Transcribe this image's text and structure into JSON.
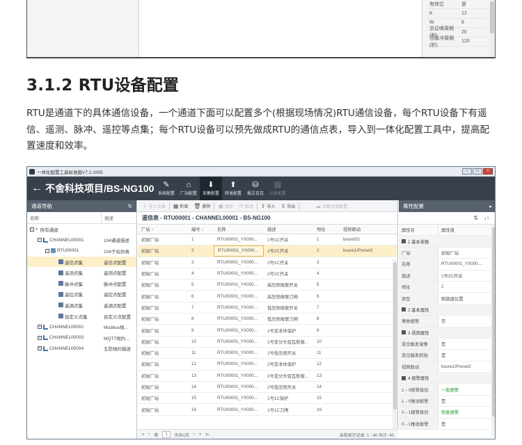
{
  "top_props": [
    {
      "k": "有效位",
      "v": "是"
    },
    {
      "k": "K",
      "v": "12"
    },
    {
      "k": "W",
      "v": "8"
    },
    {
      "k": "总召唤周期(秒)",
      "v": "20"
    },
    {
      "k": "召脉冲周期(秒)",
      "v": "120"
    }
  ],
  "section_title": "3.1.2 RTU设备配置",
  "description": "RTU是通道下的具体通信设备，一个通道下面可以配置多个(根据现场情况)RTU通信设备，每个RTU设备下有遥信、遥测、脉冲、遥控等点集；每个RTU设备可以预先做成RTU的通信点表，导入到一体化配置工具中，提高配置速度和效率。",
  "window": {
    "title": "一体化配置工具标准版V7.2.1005",
    "project": "不舍科技项目/BS-NG100",
    "tools": [
      {
        "icon": "wrench-icon",
        "glyph": "✎",
        "label": "系统配置",
        "state": "normal"
      },
      {
        "icon": "home-icon",
        "glyph": "⌂",
        "label": "厂站配置",
        "state": "normal"
      },
      {
        "icon": "download-icon",
        "glyph": "⬇",
        "label": "采集配置",
        "state": "active"
      },
      {
        "icon": "upload-icon",
        "glyph": "⬆",
        "label": "转发配置",
        "state": "normal"
      },
      {
        "icon": "log-icon",
        "glyph": "⛁",
        "label": "报文日志",
        "state": "normal"
      },
      {
        "icon": "point-file-icon",
        "glyph": "▤",
        "label": "点表配置",
        "state": "disabled"
      }
    ]
  },
  "nav": {
    "title": "通道导航",
    "col_name": "名称",
    "col_desc": "描述",
    "items": [
      {
        "name": "所有通道",
        "desc": "",
        "indent": 0,
        "icon": "all",
        "toggle": "−",
        "sel": false
      },
      {
        "name": "CHANNEL00001",
        "desc": "104通道描述",
        "indent": 1,
        "icon": "net",
        "toggle": "−",
        "sel": false
      },
      {
        "name": "RTU00001",
        "desc": "104子站仿真",
        "indent": 2,
        "icon": "dev",
        "toggle": "−",
        "sel": false
      },
      {
        "name": "遥信点集",
        "desc": "遥信点配置",
        "indent": 3,
        "icon": "pt",
        "toggle": "",
        "sel": true
      },
      {
        "name": "遥测点集",
        "desc": "遥测点配置",
        "indent": 3,
        "icon": "pt",
        "toggle": "",
        "sel": false
      },
      {
        "name": "脉冲点集",
        "desc": "脉冲点配置",
        "indent": 3,
        "icon": "pt",
        "toggle": "",
        "sel": false
      },
      {
        "name": "遥控点集",
        "desc": "遥控点配置",
        "indent": 3,
        "icon": "pt",
        "toggle": "",
        "sel": false
      },
      {
        "name": "遥调点集",
        "desc": "遥调点配置",
        "indent": 3,
        "icon": "pt",
        "toggle": "",
        "sel": false
      },
      {
        "name": "自定义点集",
        "desc": "自定义点配置",
        "indent": 3,
        "icon": "pt",
        "toggle": "",
        "sel": false
      },
      {
        "name": "CHANNEL00002",
        "desc": "Modbus规...",
        "indent": 1,
        "icon": "net",
        "toggle": "+",
        "sel": false
      },
      {
        "name": "CHANNEL00003",
        "desc": "MQTT规约...",
        "indent": 1,
        "icon": "net",
        "toggle": "+",
        "sel": false
      },
      {
        "name": "CHANNEL00004",
        "desc": "五防规约描述",
        "indent": 1,
        "icon": "net",
        "toggle": "+",
        "sel": false
      }
    ]
  },
  "toolbar": [
    {
      "icon": "import-icon",
      "glyph": "⇩",
      "label": "导入点表",
      "disabled": true
    },
    {
      "icon": "new-icon",
      "glyph": "▦",
      "label": "新增",
      "disabled": false
    },
    {
      "icon": "delete-icon",
      "glyph": "🗑",
      "label": "删除",
      "disabled": false
    },
    {
      "icon": "save-icon",
      "glyph": "▣",
      "label": "保存",
      "disabled": true
    },
    {
      "icon": "undo-icon",
      "glyph": "↺",
      "label": "取消",
      "disabled": true
    },
    {
      "icon": "import-icon",
      "glyph": "⇪",
      "label": "导入",
      "disabled": false
    },
    {
      "icon": "export-icon",
      "glyph": "⇫",
      "label": "导出",
      "disabled": false
    },
    {
      "icon": "cloud-upload-icon",
      "glyph": "☁",
      "label": "扣断点测配置",
      "disabled": true
    }
  ],
  "grid": {
    "title": "遥信表 - RTU00001 - CHANNEL00001 - BS-NG100",
    "columns": [
      "厂站 ↑",
      "编号 ↑",
      "名称",
      "描述",
      "地址",
      "视频联动"
    ],
    "rows": [
      [
        "初始厂站",
        "1",
        "RTU00001_YX000...",
        "1号1C开关",
        "1",
        "bsure5/1"
      ],
      [
        "初始厂站",
        "2",
        "RTU00001_YX000...",
        "1号2C开关",
        "2",
        "bsure1/Preset2"
      ],
      [
        "初始厂站",
        "3",
        "RTU00001_YX000...",
        "2号1C开关",
        "3",
        ""
      ],
      [
        "初始厂站",
        "4",
        "RTU00001_YX000...",
        "2号2C开关",
        "4",
        ""
      ],
      [
        "初始厂站",
        "5",
        "RTU00001_YX000...",
        "高压侧母联开关",
        "5",
        ""
      ],
      [
        "初始厂站",
        "6",
        "RTU00001_YX000...",
        "高压侧母联刀闸",
        "6",
        ""
      ],
      [
        "初始厂站",
        "7",
        "RTU00001_YX000...",
        "低压侧母联开关",
        "7",
        ""
      ],
      [
        "初始厂站",
        "8",
        "RTU00001_YX000...",
        "低压侧母联刀闸",
        "8",
        ""
      ],
      [
        "初始厂站",
        "9",
        "RTU00001_YX000...",
        "1号变本体保护",
        "9",
        ""
      ],
      [
        "初始厂站",
        "10",
        "RTU00001_YX000...",
        "1号变分头轻瓦斯报...",
        "10",
        ""
      ],
      [
        "初始厂站",
        "11",
        "RTU00001_YX000...",
        "1号低压侧开关",
        "11",
        ""
      ],
      [
        "初始厂站",
        "12",
        "RTU00001_YX000...",
        "2号变本体保护",
        "12",
        ""
      ],
      [
        "初始厂站",
        "13",
        "RTU00001_YX000...",
        "2号变分头轻瓦斯报...",
        "13",
        ""
      ],
      [
        "初始厂站",
        "14",
        "RTU00001_YX000...",
        "2号低压侧开关",
        "14",
        ""
      ],
      [
        "初始厂站",
        "15",
        "RTU00001_YX000...",
        "1号1C保护",
        "15",
        ""
      ],
      [
        "初始厂站",
        "16",
        "RTU00001_YX000...",
        "1号1C刀闸",
        "16",
        ""
      ]
    ],
    "pager": {
      "page_label": "第",
      "page": "1",
      "total": "页共1页",
      "info": "当前显示记录: 1 - 40 共计: 40"
    }
  },
  "props": {
    "title": "属性配置",
    "col_name": "属性名",
    "col_value": "属性值",
    "rows": [
      {
        "type": "group",
        "k": "1 基本参数",
        "v": ""
      },
      {
        "type": "kv",
        "k": "厂站",
        "v": "初始厂站"
      },
      {
        "type": "kv",
        "k": "名称",
        "v": "RTU00001_YX000..."
      },
      {
        "type": "kv",
        "k": "描述",
        "v": "1号2C开关"
      },
      {
        "type": "kv",
        "k": "地址",
        "v": "2"
      },
      {
        "type": "kv",
        "k": "类型",
        "v": "断路器位置"
      },
      {
        "type": "group",
        "k": "2 基本属性",
        "v": ""
      },
      {
        "type": "kv",
        "k": "事故报警",
        "v": "否"
      },
      {
        "type": "group",
        "k": "3 视频属性",
        "v": ""
      },
      {
        "type": "kv",
        "k": "变位触发录像",
        "v": "是"
      },
      {
        "type": "kv",
        "k": "变位触发抓拍",
        "v": "是"
      },
      {
        "type": "kv",
        "k": "视频联动",
        "v": "bsure1/Preset2"
      },
      {
        "type": "group",
        "k": "4 报警属性",
        "v": ""
      },
      {
        "type": "kv",
        "k": "1→0报警级别",
        "v": "一般报警",
        "green": true
      },
      {
        "type": "kv",
        "k": "1→0推送报警",
        "v": "是"
      },
      {
        "type": "kv",
        "k": "0→1报警级别",
        "v": "恢复报警",
        "green": true
      },
      {
        "type": "kv",
        "k": "0→1推送报警",
        "v": "是"
      }
    ]
  }
}
